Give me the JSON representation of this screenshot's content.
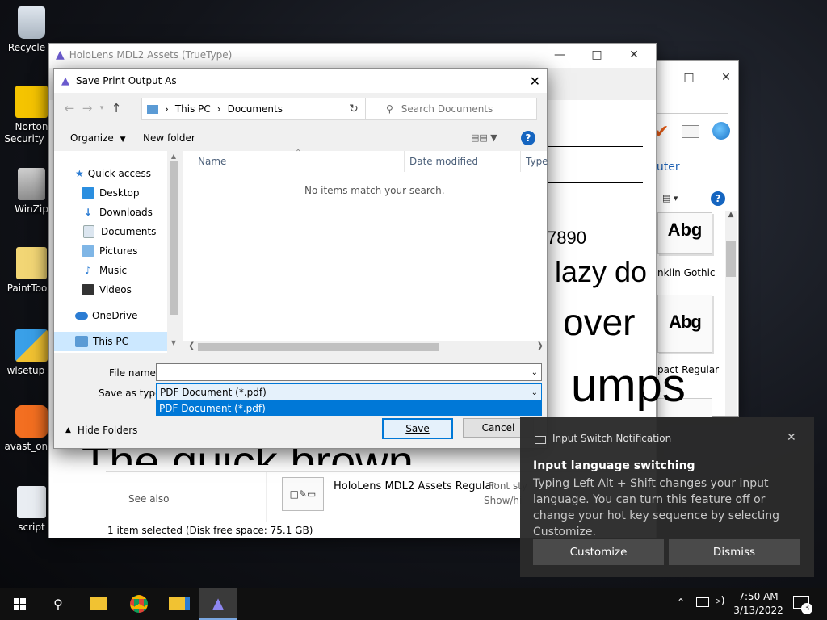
{
  "desktop": {
    "icons": [
      {
        "label": "Recycle B"
      },
      {
        "label": "Norton Security Sc"
      },
      {
        "label": "WinZip"
      },
      {
        "label": "PaintToolS"
      },
      {
        "label": "wlsetup-w"
      },
      {
        "label": "avast_one_"
      },
      {
        "label": "script"
      }
    ]
  },
  "font_window": {
    "title": "HoloLens MDL2 Assets (TrueType)",
    "sample_texts": [
      "7890",
      "lazy do",
      "over",
      "umps",
      "The quick brown"
    ],
    "see_also": "See also",
    "font_name": "HoloLens MDL2 Assets Regular",
    "font_style_label": "Font sty",
    "show_hide_label": "Show/hi",
    "status": "1 item selected (Disk free space: 75.1 GB)"
  },
  "fonts_window": {
    "link": "puter",
    "fonts": [
      {
        "sample": "Abg",
        "label": "nklin Gothic"
      },
      {
        "sample": "Abg",
        "label": "pact Regular"
      }
    ]
  },
  "dialog": {
    "title": "Save Print Output As",
    "breadcrumb": [
      "This PC",
      "Documents"
    ],
    "search_placeholder": "Search Documents",
    "organize": "Organize",
    "new_folder": "New folder",
    "nav": {
      "quick_access": "Quick access",
      "items": [
        "Desktop",
        "Downloads",
        "Documents",
        "Pictures",
        "Music",
        "Videos"
      ],
      "onedrive": "OneDrive",
      "this_pc": "This PC"
    },
    "columns": {
      "name": "Name",
      "date_modified": "Date modified",
      "type": "Type"
    },
    "empty_message": "No items match your search.",
    "file_name_label": "File name:",
    "file_name_value": "",
    "save_as_type_label": "Save as type:",
    "save_as_type_value": "PDF Document (*.pdf)",
    "dropdown_option": "PDF Document (*.pdf)",
    "hide_folders": "Hide Folders",
    "save_button": "Save",
    "cancel_button": "Cancel"
  },
  "toast": {
    "app": "Input Switch Notification",
    "title": "Input language switching",
    "body": "Typing Left Alt + Shift changes your input language. You can turn this feature off or change your hot key sequence by selecting Customize.",
    "customize": "Customize",
    "dismiss": "Dismiss"
  },
  "taskbar": {
    "time": "7:50 AM",
    "date": "3/13/2022",
    "notification_count": "3"
  }
}
